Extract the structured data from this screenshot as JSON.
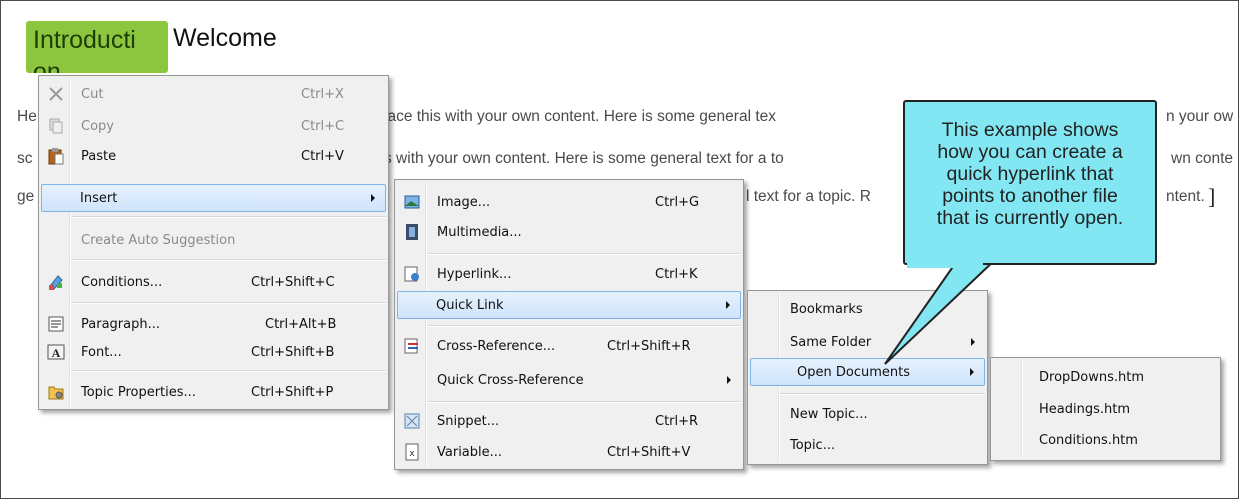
{
  "document": {
    "tag_label": "Introduction",
    "heading": "Welcome",
    "paragraph_fragments": {
      "line1_left": "He",
      "line1_mid": "lace this with your own content. Here is some general tex",
      "line1_right": "n your ow",
      "line2_left": "sc",
      "line2_mid": "s with your own content. Here is some general text for a to",
      "line2_right": "wn conte",
      "line3_left": "ge",
      "line3_mid": "l text for a topic. R",
      "line3_right": "ntent."
    }
  },
  "context_menu": {
    "items": [
      {
        "label": "Cut",
        "shortcut": "Ctrl+X",
        "icon": "cut-icon",
        "disabled": true
      },
      {
        "label": "Copy",
        "shortcut": "Ctrl+C",
        "icon": "copy-icon",
        "disabled": true
      },
      {
        "label": "Paste",
        "shortcut": "Ctrl+V",
        "icon": "paste-icon"
      },
      {
        "label": "Insert",
        "icon": "none",
        "submenu": true,
        "highlighted": true
      },
      {
        "label": "Create Auto Suggestion",
        "disabled": true
      },
      {
        "label": "Conditions...",
        "shortcut": "Ctrl+Shift+C",
        "icon": "conditions-icon"
      },
      {
        "label": "Paragraph...",
        "shortcut": "Ctrl+Alt+B",
        "icon": "paragraph-icon"
      },
      {
        "label": "Font...",
        "shortcut": "Ctrl+Shift+B",
        "icon": "font-icon"
      },
      {
        "label": "Topic Properties...",
        "shortcut": "Ctrl+Shift+P",
        "icon": "topic-properties-icon"
      }
    ]
  },
  "insert_menu": {
    "items": [
      {
        "label": "Image...",
        "shortcut": "Ctrl+G",
        "icon": "image-icon"
      },
      {
        "label": "Multimedia...",
        "icon": "multimedia-icon"
      },
      {
        "label": "Hyperlink...",
        "shortcut": "Ctrl+K",
        "icon": "hyperlink-icon"
      },
      {
        "label": "Quick Link",
        "submenu": true,
        "highlighted": true
      },
      {
        "label": "Cross-Reference...",
        "shortcut": "Ctrl+Shift+R",
        "icon": "cross-reference-icon"
      },
      {
        "label": "Quick Cross-Reference",
        "submenu": true
      },
      {
        "label": "Snippet...",
        "shortcut": "Ctrl+R",
        "icon": "snippet-icon"
      },
      {
        "label": "Variable...",
        "shortcut": "Ctrl+Shift+V",
        "icon": "variable-icon"
      }
    ]
  },
  "quick_link_menu": {
    "items": [
      {
        "label": "Bookmarks",
        "bold": true
      },
      {
        "label": "Same Folder",
        "submenu": true
      },
      {
        "label": "Open Documents",
        "submenu": true,
        "highlighted": true
      },
      {
        "label": "New Topic..."
      },
      {
        "label": "Topic..."
      }
    ]
  },
  "open_documents_menu": {
    "items": [
      {
        "label": "DropDowns.htm"
      },
      {
        "label": "Headings.htm"
      },
      {
        "label": "Conditions.htm"
      }
    ]
  },
  "callout": {
    "lines": [
      "This example shows",
      "how you can create a",
      "quick hyperlink that",
      "points to another file",
      "that is currently open."
    ],
    "color": "#82e7f2"
  },
  "colors": {
    "highlight": "#cfe4fb",
    "tag": "#8cc63f"
  }
}
